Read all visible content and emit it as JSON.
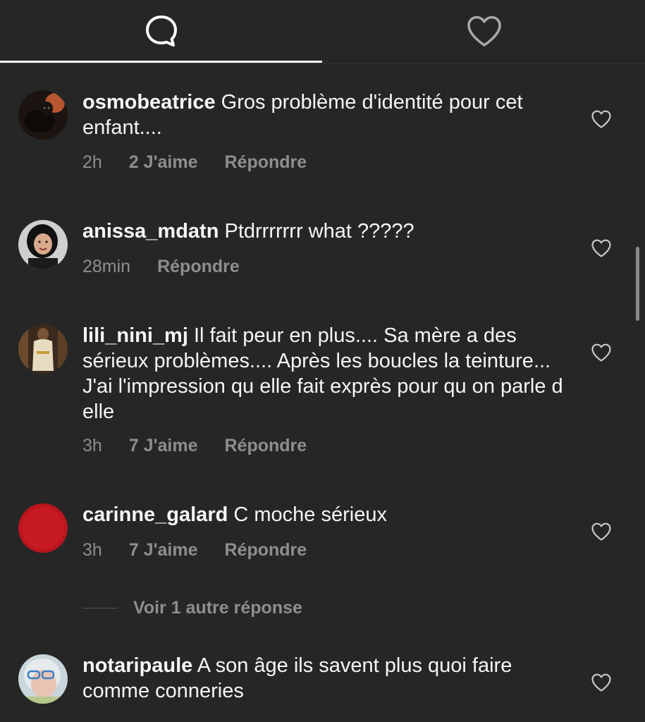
{
  "tabs": [
    {
      "icon": "comment-icon",
      "active": true
    },
    {
      "icon": "heart-icon",
      "active": false
    }
  ],
  "comments": [
    {
      "username": "osmobeatrice",
      "text": "Gros problème d'identité pour cet enfant....",
      "time": "2h",
      "likes": "2 J'aime",
      "reply": "Répondre"
    },
    {
      "username": "anissa_mdatn",
      "text": "Ptdrrrrrrr what ?????",
      "time": "28min",
      "likes": "",
      "reply": "Répondre"
    },
    {
      "username": "lili_nini_mj",
      "text": "Il fait peur en plus.... Sa mère a des sérieux problèmes.... Après les boucles la teinture... J'ai l'impression qu elle fait exprès pour qu on parle d elle",
      "time": "3h",
      "likes": "7 J'aime",
      "reply": "Répondre"
    },
    {
      "username": "carinne_galard",
      "text": "C moche sérieux",
      "time": "3h",
      "likes": "7 J'aime",
      "reply": "Répondre"
    },
    {
      "username": "notaripaule",
      "text": "A son âge ils savent plus quoi faire comme conneries",
      "time": "",
      "likes": "",
      "reply": ""
    }
  ],
  "view_more": "Voir 1 autre réponse",
  "colors": {
    "background": "#262626",
    "text": "#f5f5f5",
    "muted": "#8e8e8e",
    "accent": "#ffffff"
  }
}
